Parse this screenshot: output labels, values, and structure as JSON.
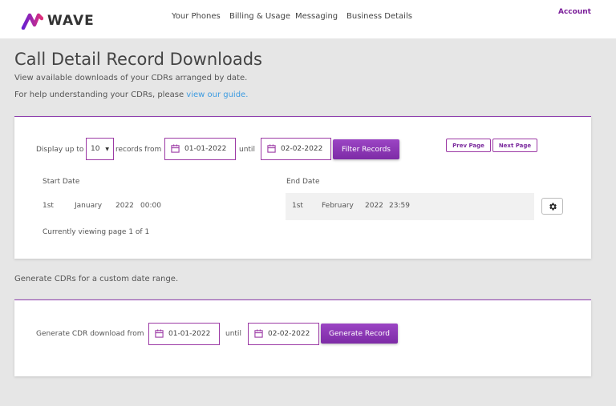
{
  "brand": {
    "name": "WAVE"
  },
  "nav": {
    "links": [
      "Your Phones",
      "Billing & Usage",
      "Messaging",
      "Business Details"
    ],
    "account": "Account"
  },
  "page": {
    "title": "Call Detail Record Downloads",
    "subtitle": "View available downloads of your CDRs arranged by date.",
    "help_prefix": "For help understanding your CDRs, please ",
    "help_link": "view our guide."
  },
  "filter": {
    "display_up_to": "Display up to",
    "records_value": "10",
    "records_from": "records from",
    "from_date": "01-01-2022",
    "until": "until",
    "to_date": "02-02-2022",
    "filter_button": "Filter Records",
    "prev_page": "Prev Page",
    "next_page": "Next Page"
  },
  "records": {
    "start_header": "Start Date",
    "end_header": "End Date",
    "start": {
      "day": "1st",
      "month": "January",
      "year": "2022",
      "time": "00:00"
    },
    "end": {
      "day": "1st",
      "month": "February",
      "year": "2022",
      "time": "23:59"
    },
    "paging": "Currently viewing page 1 of 1"
  },
  "custom": {
    "intro": "Generate CDRs for a custom date range.",
    "label": "Generate CDR download from",
    "from_date": "01-01-2022",
    "until": "until",
    "to_date": "02-02-2022",
    "button": "Generate Record"
  },
  "icons": {
    "calendar": "calendar-icon",
    "gear": "gear-icon",
    "caret": "caret-down-icon",
    "logo": "wave-logo-icon"
  },
  "colors": {
    "accent": "#8e3fae",
    "button": "#8a35b5",
    "link": "#3d9be0",
    "background": "#e6e6e6"
  }
}
